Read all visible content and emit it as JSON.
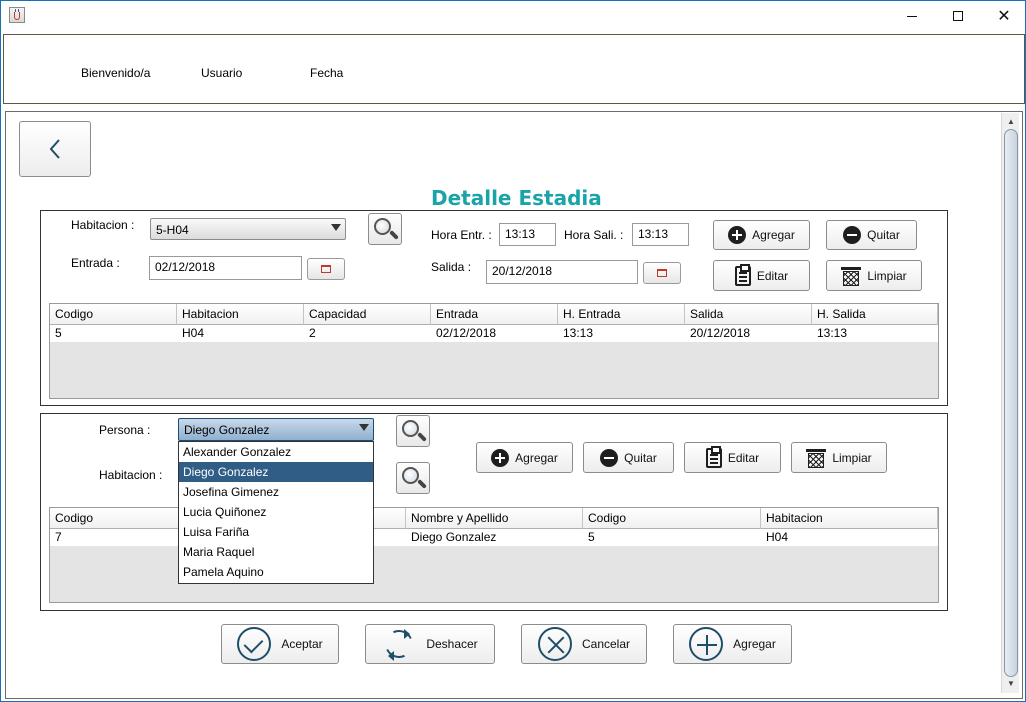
{
  "header": {
    "bienvenido": "Bienvenido/a",
    "usuario": "Usuario",
    "fecha": "Fecha"
  },
  "title": "Detalle Estadia",
  "estadia": {
    "habitacion_label": "Habitacion :",
    "habitacion_value": "5-H04",
    "entrada_label": "Entrada :",
    "entrada_value": "02/12/2018",
    "hora_entr_label": "Hora Entr. :",
    "hora_entr_value": "13:13",
    "hora_sali_label": "Hora Sali. :",
    "hora_sali_value": "13:13",
    "salida_label": "Salida :",
    "salida_value": "20/12/2018",
    "buttons": {
      "agregar": "Agregar",
      "quitar": "Quitar",
      "editar": "Editar",
      "limpiar": "Limpiar"
    },
    "table": {
      "columns": [
        "Codigo",
        "Habitacion",
        "Capacidad",
        "Entrada",
        "H. Entrada",
        "Salida",
        "H. Salida"
      ],
      "rows": [
        [
          "5",
          "H04",
          "2",
          "02/12/2018",
          "13:13",
          "20/12/2018",
          "13:13"
        ]
      ]
    }
  },
  "personas": {
    "persona_label": "Persona :",
    "persona_value": "Diego Gonzalez",
    "habitacion_label": "Habitacion :",
    "options": [
      "Alexander Gonzalez",
      "Diego Gonzalez",
      "Josefina Gimenez",
      "Lucia Quiñonez",
      "Luisa Fariña",
      "Maria Raquel",
      "Pamela Aquino"
    ],
    "selected_option": "Diego Gonzalez",
    "buttons": {
      "agregar": "Agregar",
      "quitar": "Quitar",
      "editar": "Editar",
      "limpiar": "Limpiar"
    },
    "table": {
      "columns": [
        "Codigo",
        "",
        "Nombre y Apellido",
        "Codigo",
        "Habitacion"
      ],
      "rows": [
        [
          "7",
          "",
          "Diego Gonzalez",
          "5",
          "H04"
        ]
      ]
    }
  },
  "footer": {
    "aceptar": "Aceptar",
    "deshacer": "Deshacer",
    "cancelar": "Cancelar",
    "agregar": "Agregar"
  },
  "colors": {
    "title": "#1aa3a8",
    "selection": "#2f5d85",
    "icon_ring": "#1f4e68"
  }
}
